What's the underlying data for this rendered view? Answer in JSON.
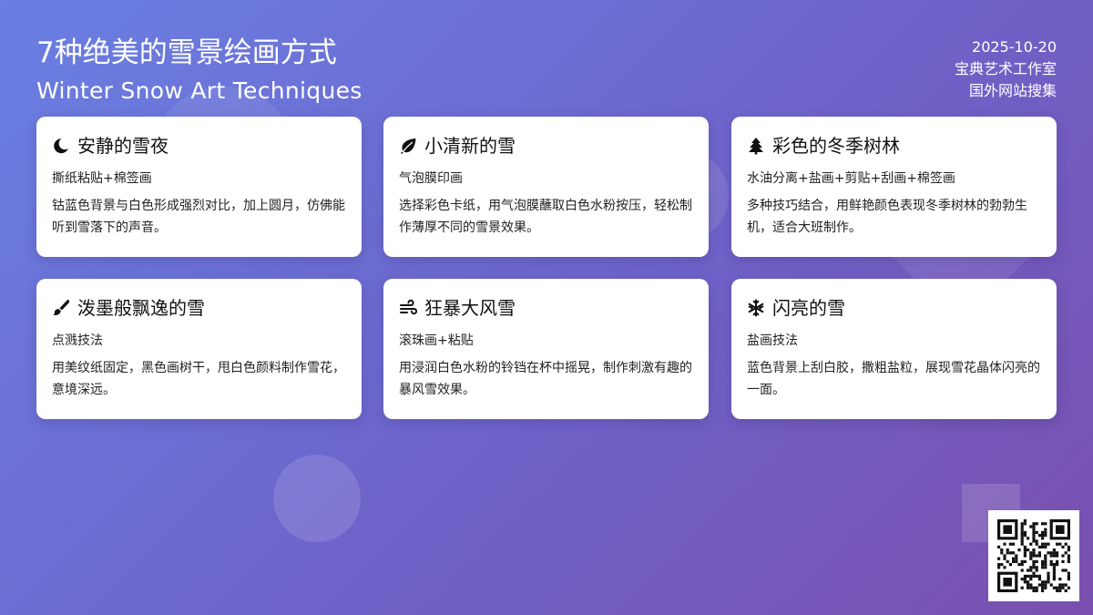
{
  "header": {
    "title": "7种绝美的雪景绘画方式",
    "subtitle": "Winter Snow Art Techniques",
    "date": "2025-10-20",
    "studio": "宝典艺术工作室",
    "source": "国外网站搜集"
  },
  "cards": [
    {
      "icon": "moon-icon",
      "title": "安静的雪夜",
      "method": "撕纸粘贴+棉签画",
      "desc": "钴蓝色背景与白色形成强烈对比，加上圆月，仿佛能听到雪落下的声音。"
    },
    {
      "icon": "leaf-icon",
      "title": "小清新的雪",
      "method": "气泡膜印画",
      "desc": "选择彩色卡纸，用气泡膜蘸取白色水粉按压，轻松制作薄厚不同的雪景效果。"
    },
    {
      "icon": "tree-icon",
      "title": "彩色的冬季树林",
      "method": "水油分离+盐画+剪贴+刮画+棉签画",
      "desc": "多种技巧结合，用鲜艳颜色表现冬季树林的勃勃生机，适合大班制作。"
    },
    {
      "icon": "paintbrush-icon",
      "title": "泼墨般飘逸的雪",
      "method": "点溅技法",
      "desc": "用美纹纸固定，黑色画树干，甩白色颜料制作雪花，意境深远。"
    },
    {
      "icon": "wind-icon",
      "title": "狂暴大风雪",
      "method": "滚珠画+粘贴",
      "desc": "用浸润白色水粉的铃铛在杯中摇晃，制作刺激有趣的暴风雪效果。"
    },
    {
      "icon": "snowflake-icon",
      "title": "闪亮的雪",
      "method": "盐画技法",
      "desc": "蓝色背景上刮白胶，撒粗盐粒，展现雪花晶体闪亮的一面。"
    }
  ],
  "qr_code": {
    "icon": "qr-code-icon"
  }
}
